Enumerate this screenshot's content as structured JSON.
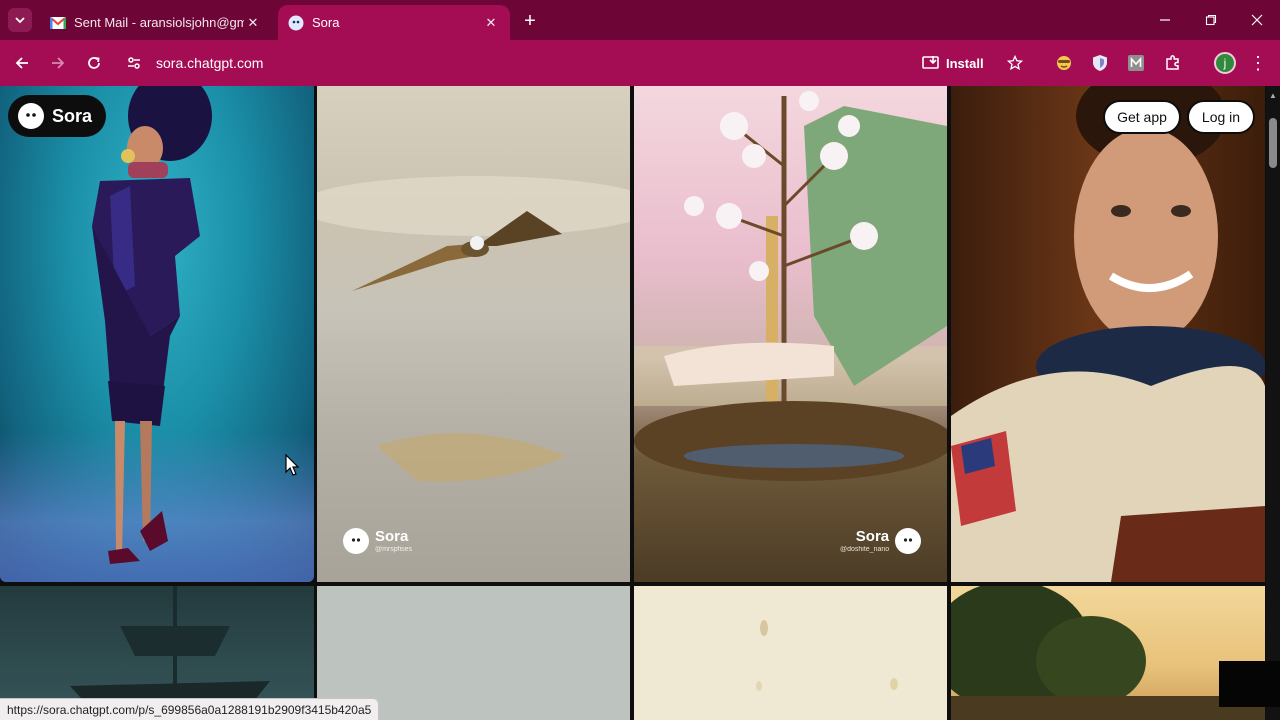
{
  "browser": {
    "tabs": [
      {
        "title": "Sent Mail - aransiolsjohn@gma",
        "favicon": "gmail-icon",
        "active": false
      },
      {
        "title": "Sora",
        "favicon": "sora-icon",
        "active": true
      }
    ],
    "url": "sora.chatgpt.com",
    "install_label": "Install",
    "profile_initial": "j",
    "colors": {
      "tabbar": "#6e0537",
      "toolbar": "#a40d54"
    }
  },
  "page": {
    "logo_text": "Sora",
    "get_app_label": "Get app",
    "log_in_label": "Log in",
    "watermarks": [
      {
        "brand": "Sora",
        "handle": "@mrspfises"
      },
      {
        "brand": "Sora",
        "handle": "@doshite_nano"
      }
    ]
  },
  "status_bar": {
    "link": "https://sora.chatgpt.com/p/s_699856a0a1288191b2909f3415b420a5"
  }
}
